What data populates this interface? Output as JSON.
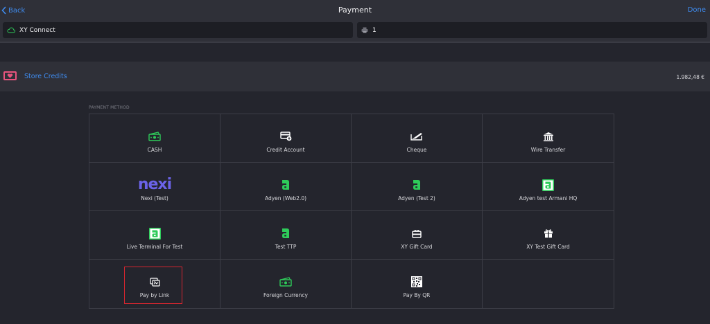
{
  "nav": {
    "back_label": "Back",
    "title": "Payment",
    "done_label": "Done"
  },
  "fields": {
    "connect_label": "XY Connect",
    "printer_value": "1"
  },
  "store_credits": {
    "label": "Store Credits",
    "amount": "1.982,48 €"
  },
  "payment": {
    "section_title": "PAYMENT METHOD",
    "methods": [
      {
        "label": "CASH",
        "icon": "cash-icon"
      },
      {
        "label": "Credit Account",
        "icon": "credit-account-icon"
      },
      {
        "label": "Cheque",
        "icon": "cheque-icon"
      },
      {
        "label": "Wire Transfer",
        "icon": "bank-icon"
      },
      {
        "label": "Nexi (Test)",
        "icon": "nexi-logo",
        "logo_text": "nexi"
      },
      {
        "label": "Adyen (Web2.0)",
        "icon": "adyen-icon"
      },
      {
        "label": "Adyen (Test 2)",
        "icon": "adyen-icon"
      },
      {
        "label": "Adyen test Armani HQ",
        "icon": "adyen-icon"
      },
      {
        "label": "Live Terminal For Test",
        "icon": "adyen-icon"
      },
      {
        "label": "Test TTP",
        "icon": "adyen-icon"
      },
      {
        "label": "XY Gift Card",
        "icon": "gift-card-icon"
      },
      {
        "label": "XY Test Gift Card",
        "icon": "gift-icon"
      },
      {
        "label": "Pay by Link",
        "icon": "pay-link-icon"
      },
      {
        "label": "Foreign Currency",
        "icon": "cash-icon"
      },
      {
        "label": "Pay By QR",
        "icon": "qr-code-icon"
      }
    ]
  },
  "colors": {
    "accent": "#3f8cf0",
    "green": "#2ecc5a",
    "nexi": "#6b63e8",
    "credit_badge": "#e8547e",
    "selection": "#d8262f"
  }
}
